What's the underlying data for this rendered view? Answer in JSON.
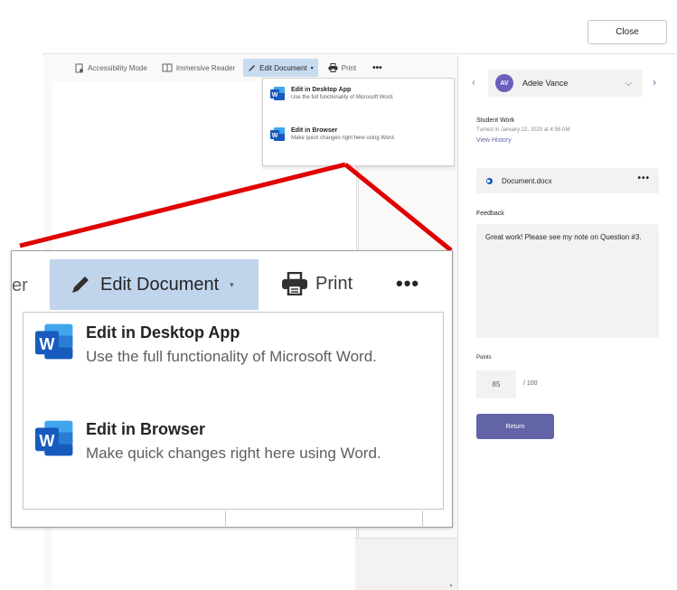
{
  "topbar": {
    "close_label": "Close"
  },
  "toolbar": {
    "accessibility_label": "Accessibility Mode",
    "immersive_label": "Immersive Reader",
    "edit_label": "Edit Document",
    "print_label": "Print"
  },
  "edit_menu": {
    "items": [
      {
        "title": "Edit in Desktop App",
        "desc": "Use the full functionality of Microsoft Word.",
        "icon": "word-icon"
      },
      {
        "title": "Edit in Browser",
        "desc": "Make quick changes right here using Word.",
        "icon": "word-icon"
      }
    ]
  },
  "zoom": {
    "partial_label": "er",
    "edit_label": "Edit Document",
    "print_label": "Print"
  },
  "panel": {
    "student": {
      "initials": "AV",
      "name": "Adele Vance"
    },
    "student_work_title": "Student Work",
    "turned_in": "Turned in January 22, 2020 at 4:56 AM",
    "view_history": "View History",
    "document_name": "Document.docx",
    "feedback_label": "Feedback",
    "feedback_text": "Great work! Please see my note on Question #3.",
    "points_label": "Points",
    "points_value": "85",
    "points_max": "/ 100",
    "return_label": "Return"
  },
  "colors": {
    "accent": "#6264a7",
    "highlight": "#c7dcf0",
    "annotation": "#e00000",
    "word_blue": "#185abd"
  }
}
